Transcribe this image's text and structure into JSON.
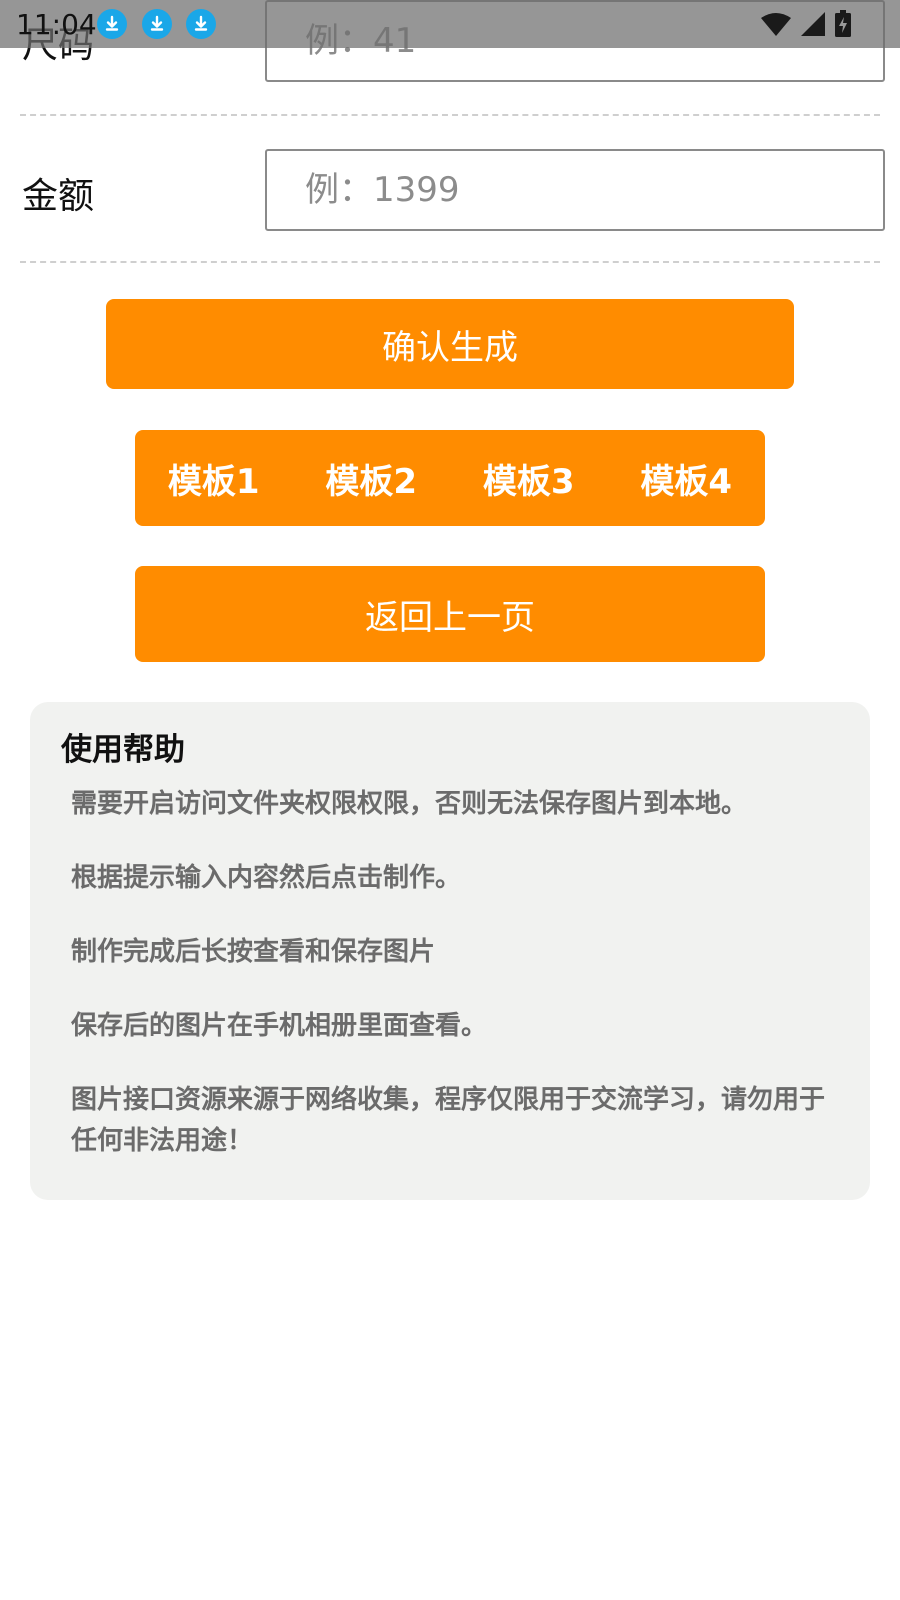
{
  "status_bar": {
    "time": "11:04",
    "notification_icons": [
      "download-icon",
      "download-icon",
      "download-icon"
    ],
    "right_icons": [
      "wifi-icon",
      "cell-signal-icon",
      "battery-charging-icon"
    ]
  },
  "form": {
    "size": {
      "label": "尺码",
      "placeholder": "例：41"
    },
    "amount": {
      "label": "金额",
      "placeholder": "例：1399"
    }
  },
  "buttons": {
    "confirm": "确认生成",
    "templates": [
      "模板1",
      "模板2",
      "模板3",
      "模板4"
    ],
    "back": "返回上一页"
  },
  "help": {
    "title": "使用帮助",
    "items": [
      "需要开启访问文件夹权限权限，否则无法保存图片到本地。",
      "根据提示输入内容然后点击制作。",
      "制作完成后长按查看和保存图片",
      "保存后的图片在手机相册里面查看。",
      "图片接口资源来源于网络收集，程序仅限用于交流学习，请勿用于任何非法用途！"
    ]
  },
  "colors": {
    "accent": "#ff8c00",
    "help_background": "#f1f2f0",
    "help_text": "#6b6b6b",
    "status_icon_blue": "#1aa7e8"
  }
}
